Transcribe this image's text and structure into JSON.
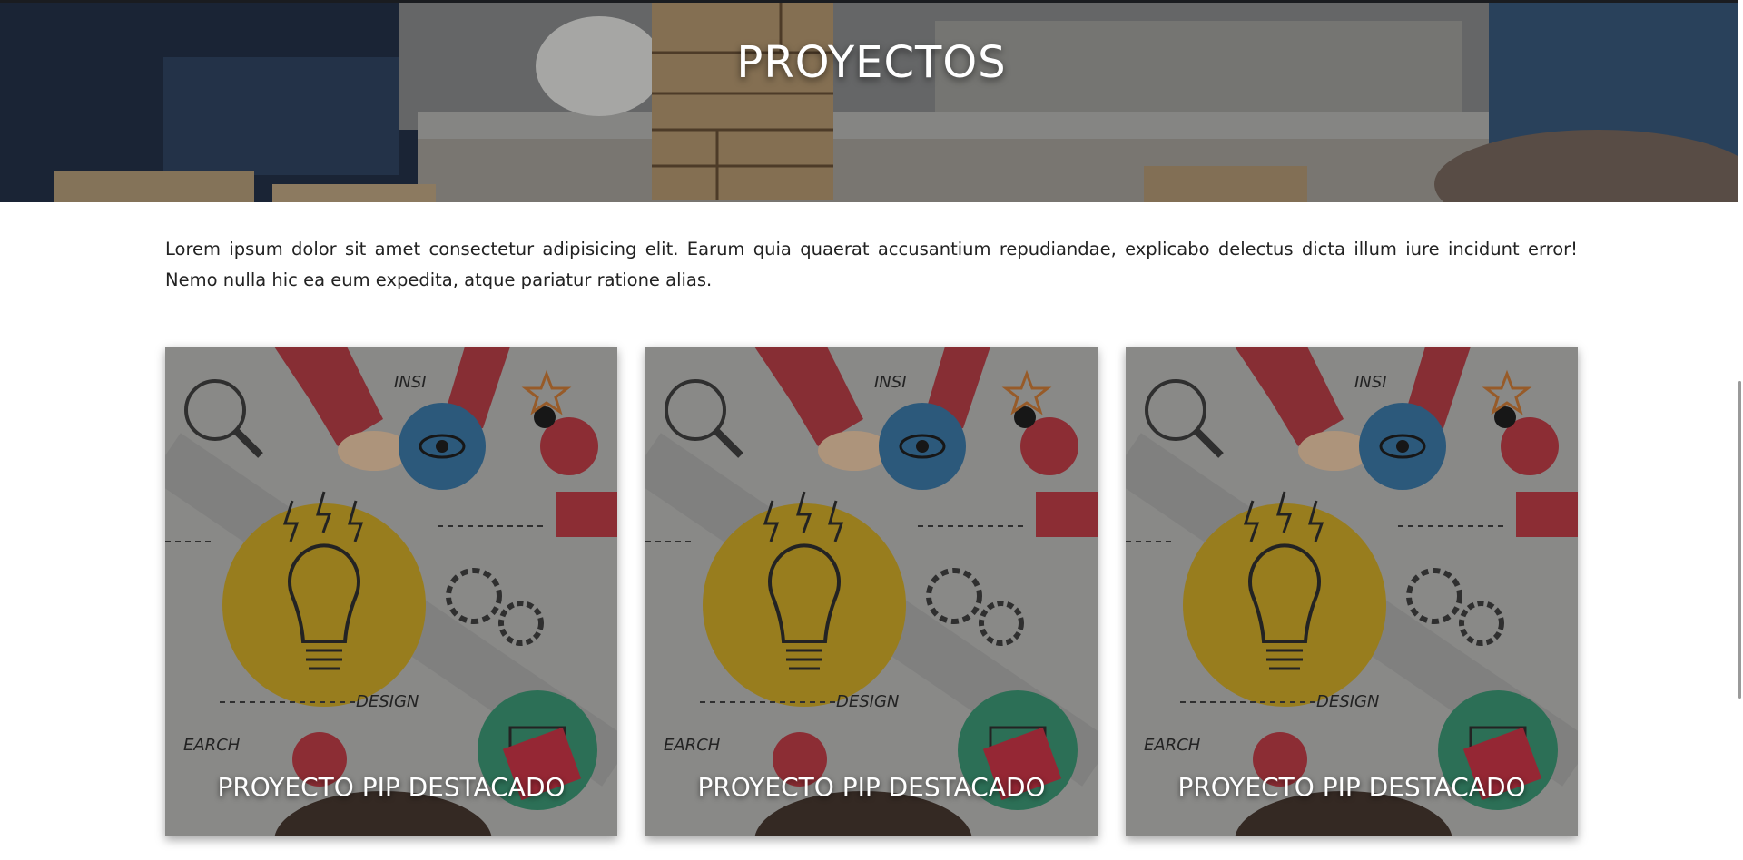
{
  "hero": {
    "title": "PROYECTOS"
  },
  "intro": {
    "text": "Lorem ipsum dolor sit amet consectetur adipisicing elit. Earum quia quaerat accusantium repudiandae, explicabo delectus dicta illum iure incidunt error! Nemo nulla hic ea eum expedita, atque pariatur ratione alias."
  },
  "cards": [
    {
      "title": "PROYECTO PIP DESTACADO",
      "art_words": [
        "INSI",
        "DESIGN",
        "EARCH"
      ]
    },
    {
      "title": "PROYECTO PIP DESTACADO",
      "art_words": [
        "INSI",
        "DESIGN",
        "EARCH"
      ]
    },
    {
      "title": "PROYECTO PIP DESTACADO",
      "art_words": [
        "INSI",
        "DESIGN",
        "EARCH"
      ]
    }
  ],
  "colors": {
    "overlay_text": "#ffffff",
    "bulb_yellow": "#c9a21a",
    "eye_blue": "#2e6fa0",
    "red": "#b8303a",
    "green": "#2f8f6a"
  }
}
